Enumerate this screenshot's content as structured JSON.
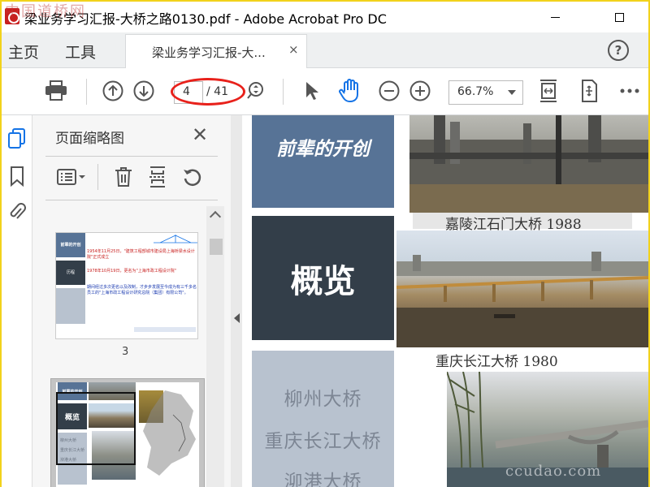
{
  "window": {
    "title": "梁业务学习汇报-大桥之路0130.pdf - Adobe Acrobat Pro DC",
    "watermark": "中国道桥网"
  },
  "menubar": {
    "home": "主页",
    "tools": "工具",
    "doc_tab": "梁业务学习汇报-大...",
    "close": "×",
    "help": "?"
  },
  "toolbar": {
    "current_page": "4",
    "total_pages": "/ 41",
    "zoom": "66.7%"
  },
  "thumbnails": {
    "panel_title": "页面缩略图",
    "close": "✕",
    "page_label": "3",
    "thumb1": {
      "sidebar_labels": [
        "前辈的开创",
        "历程"
      ],
      "lines": [
        "1954年11月25日，\"建筑工程部城市建设局上海桥梁水设计院\"正式成立",
        "1978年10月19日，更名为\"上海市政工程设计院\"",
        "期间经过多次更名以及改制，才步步发展至今成为有三千多名员工的\"上海市政工程设计研究总院（集团）有限公司\"。"
      ]
    },
    "thumb2": {
      "labels": [
        "前辈的开创",
        "概览",
        "柳州大桥",
        "重庆长江大桥",
        "泖港大桥"
      ]
    }
  },
  "document": {
    "box_blue_text": "前辈的开创",
    "box_dark_text": "概览",
    "box_grey_items": [
      "柳州大桥",
      "重庆长江大桥",
      "泖港大桥"
    ],
    "caption1": "嘉陵江石门大桥 1988",
    "caption2": "重庆长江大桥 1980",
    "watermark": "ccudao.com"
  },
  "colors": {
    "accent_blue": "#577396",
    "dark_box": "#333e49",
    "grey_box": "#b8c2cf",
    "annotation_red": "#e8211b",
    "acrobat_blue": "#1473e6"
  }
}
